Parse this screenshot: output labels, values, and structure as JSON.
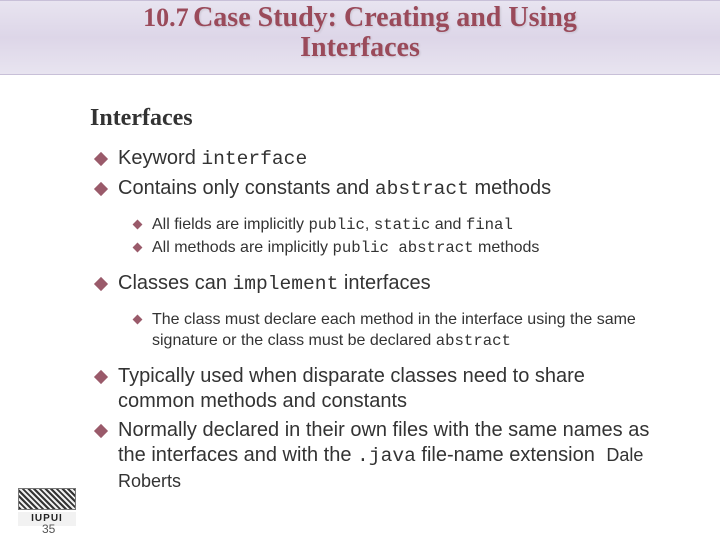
{
  "header": {
    "number": "10.7",
    "title_line1": "Case Study: Creating and Using",
    "title_line2": "Interfaces"
  },
  "section": {
    "heading": "Interfaces",
    "bullets": [
      {
        "level": 1,
        "prefix": "Keyword ",
        "code": "interface",
        "suffix": ""
      },
      {
        "level": 1,
        "prefix": "Contains only constants and ",
        "code": "abstract",
        "suffix": " methods"
      },
      {
        "level": 2,
        "prefix": "All fields are implicitly ",
        "code": "public",
        "mid": ", ",
        "code2": "static",
        "mid2": " and ",
        "code3": "final",
        "suffix": ""
      },
      {
        "level": 2,
        "prefix": "All methods are implicitly ",
        "code": "public abstract",
        "suffix": " methods"
      },
      {
        "level": 1,
        "prefix": "Classes can ",
        "code": "implement",
        "suffix": " interfaces"
      },
      {
        "level": 2,
        "prefix": "The class must declare each method in the interface using the same signature or the class must be declared ",
        "code": "abstract",
        "suffix": ""
      },
      {
        "level": 1,
        "prefix": "Typically used when disparate classes need to share common methods and constants",
        "code": "",
        "suffix": ""
      },
      {
        "level": 1,
        "prefix": "Normally declared in their own files with the same names as the interfaces and with the ",
        "code": ".java",
        "suffix": " file-name extension"
      }
    ]
  },
  "footer": {
    "page_number": "35",
    "author": "Dale Roberts",
    "logo_text": "IUPUI"
  }
}
